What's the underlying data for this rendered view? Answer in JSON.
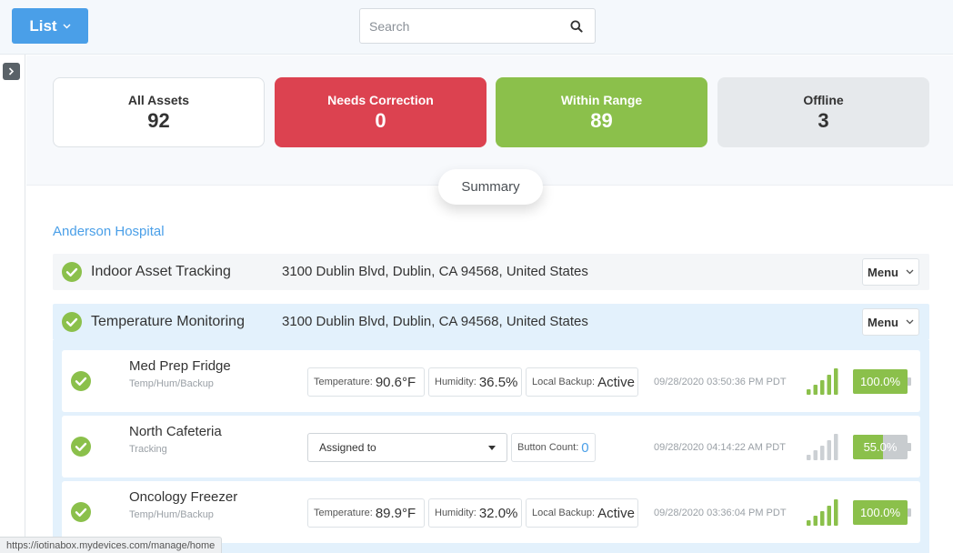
{
  "header": {
    "list_label": "List",
    "search_placeholder": "Search"
  },
  "summary_cards": {
    "all": {
      "label": "All Assets",
      "value": "92"
    },
    "needs_correction": {
      "label": "Needs Correction",
      "value": "0"
    },
    "within_range": {
      "label": "Within Range",
      "value": "89"
    },
    "offline": {
      "label": "Offline",
      "value": "3"
    }
  },
  "summary_toggle_label": "Summary",
  "hospital_name": "Anderson Hospital",
  "locations": [
    {
      "name": "Indoor Asset Tracking",
      "address": "3100 Dublin Blvd, Dublin, CA 94568, United States",
      "menu_label": "Menu"
    },
    {
      "name": "Temperature Monitoring",
      "address": "3100 Dublin Blvd, Dublin, CA 94568, United States",
      "menu_label": "Menu"
    }
  ],
  "devices": [
    {
      "name": "Med Prep Fridge",
      "type": "Temp/Hum/Backup",
      "temperature_label": "Temperature:",
      "temperature_value": "90.6°F",
      "humidity_label": "Humidity:",
      "humidity_value": "36.5%",
      "backup_label": "Local Backup:",
      "backup_value": "Active",
      "timestamp": "09/28/2020 03:50:36 PM PDT",
      "signal_bars": 5,
      "battery_text": "100.0%",
      "battery_level": 100
    },
    {
      "name": "North Cafeteria",
      "type": "Tracking",
      "assigned_label": "Assigned to",
      "button_count_label": "Button Count:",
      "button_count_value": "0",
      "timestamp": "09/28/2020 04:14:22 AM PDT",
      "signal_bars": 0,
      "battery_text": "55.0%",
      "battery_level": 55
    },
    {
      "name": "Oncology Freezer",
      "type": "Temp/Hum/Backup",
      "temperature_label": "Temperature:",
      "temperature_value": "89.9°F",
      "humidity_label": "Humidity:",
      "humidity_value": "32.0%",
      "backup_label": "Local Backup:",
      "backup_value": "Active",
      "timestamp": "09/28/2020 03:36:04 PM PDT",
      "signal_bars": 5,
      "battery_text": "100.0%",
      "battery_level": 100
    }
  ],
  "status_bar_url": "https://iotinabox.mydevices.com/manage/home",
  "colors": {
    "accent_blue": "#4a9fe8",
    "danger_red": "#dc4250",
    "success_green": "#8bc04b",
    "neutral_grey": "#e6e9ec"
  }
}
